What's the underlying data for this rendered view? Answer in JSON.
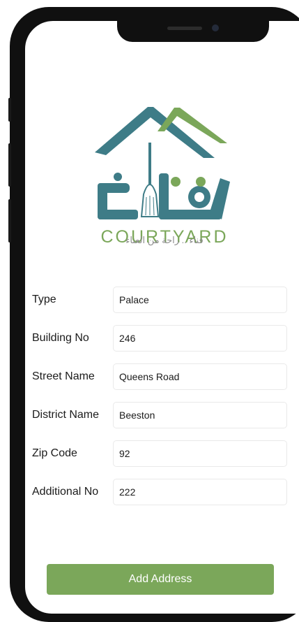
{
  "brand": {
    "logo_text": "COURTYARD",
    "logo_arabic_mark": "فناء",
    "tagline_arabic": "فناء .. راحة من العناء",
    "colors": {
      "teal": "#3e7c87",
      "green": "#7ba75a"
    }
  },
  "form": {
    "fields": [
      {
        "label": "Type",
        "value": "Palace"
      },
      {
        "label": "Building No",
        "value": "246"
      },
      {
        "label": "Street Name",
        "value": "Queens Road"
      },
      {
        "label": "District Name",
        "value": "Beeston"
      },
      {
        "label": "Zip Code",
        "value": "92"
      },
      {
        "label": "Additional No",
        "value": "222"
      }
    ],
    "submit_label": "Add Address"
  }
}
